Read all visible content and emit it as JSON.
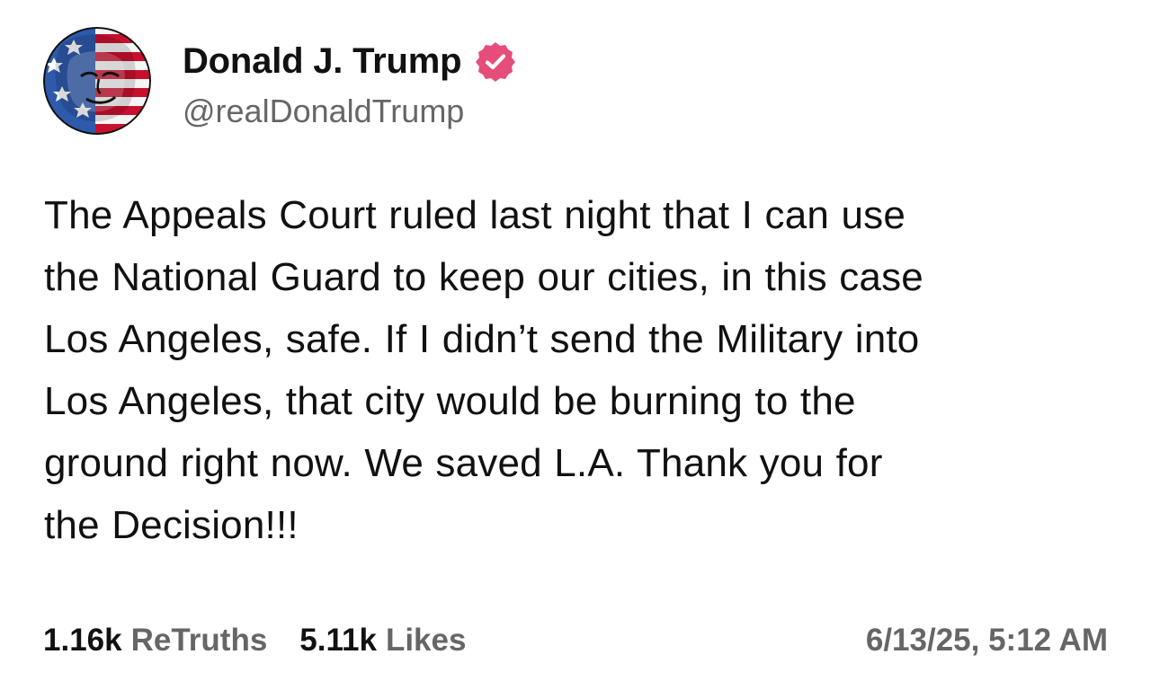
{
  "header": {
    "display_name": "Donald J. Trump",
    "handle": "@realDonaldTrump",
    "avatar": "profile-avatar",
    "verified_icon": "verified-badge-icon",
    "verified_color": "#E64D7A"
  },
  "post": {
    "lines": [
      "The Appeals Court ruled last night that I can use",
      "the National Guard to keep our cities, in this case",
      "Los Angeles, safe. If I didn’t send the Military into",
      "Los Angeles, that city would be burning to the",
      "ground right now. We saved L.A. Thank you for",
      "the Decision!!!"
    ]
  },
  "stats": {
    "retruths_count": "1.16k",
    "retruths_label": "ReTruths",
    "likes_count": "5.11k",
    "likes_label": "Likes",
    "timestamp": "6/13/25, 5:12 AM"
  },
  "colors": {
    "background": "#FFFFFF",
    "text": "#111111",
    "muted": "#666666",
    "flag_red": "#C8102E",
    "flag_blue": "#2E5AAC",
    "flag_white": "#F5F5F5"
  }
}
